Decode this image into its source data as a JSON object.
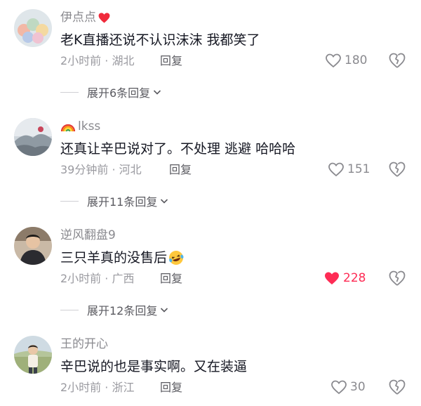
{
  "comments": [
    {
      "username": "伊点点",
      "username_suffix_icon": "red-heart-emoji",
      "text": "老K直播还说不认识沫沫 我都笑了",
      "meta": "2小时前 · 湖北",
      "reply_label": "回复",
      "likes": "180",
      "liked": false,
      "expand_label": "展开6条回复"
    },
    {
      "username_prefix_icon": "rainbow-emoji",
      "username": "lkss",
      "text": "还真让辛巴说对了。不处理 逃避 哈哈哈",
      "meta": "39分钟前 · 河北",
      "reply_label": "回复",
      "likes": "151",
      "liked": false,
      "expand_label": "展开11条回复"
    },
    {
      "username": "逆风翻盘9",
      "text": "三只羊真的没售后",
      "text_suffix_icon": "laughing-tears-emoji",
      "meta": "2小时前 · 广西",
      "reply_label": "回复",
      "likes": "228",
      "liked": true,
      "expand_label": "展开12条回复"
    },
    {
      "username": "王的开心",
      "text": "辛巴说的也是事实啊。又在装逼",
      "meta": "2小时前 · 浙江",
      "reply_label": "回复",
      "likes": "30",
      "liked": false
    }
  ],
  "colors": {
    "text_primary": "#161823",
    "text_secondary": "#8a8a8f",
    "like_active": "#fe2c55"
  }
}
